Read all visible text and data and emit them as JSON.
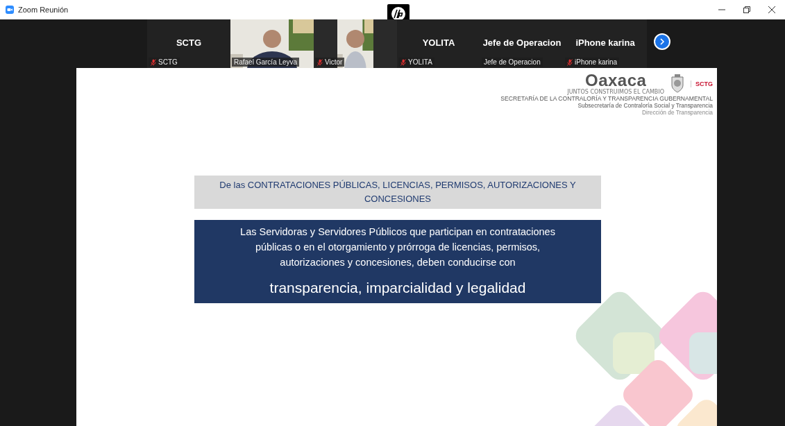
{
  "window": {
    "title": "Zoom Reunión"
  },
  "participants": [
    {
      "kind": "text",
      "display_name": "SCTG",
      "label": "SCTG",
      "muted": true
    },
    {
      "kind": "video",
      "label": "Rafael García Leyva",
      "muted": false
    },
    {
      "kind": "video_narrow",
      "label": "Victor",
      "muted": true
    },
    {
      "kind": "text",
      "display_name": "YOLITA",
      "label": "YOLITA",
      "muted": true
    },
    {
      "kind": "text",
      "display_name": "Jefe de Operacion",
      "label": "Jefe de Operacion",
      "muted": false
    },
    {
      "kind": "text",
      "display_name": "iPhone karina",
      "label": "iPhone karina",
      "muted": true
    }
  ],
  "slide": {
    "logo": {
      "word": "Oaxaca",
      "motto": "JUNTOS CONSTRUIMOS EL CAMBIO",
      "badge": "SCTG"
    },
    "header_lines": [
      "SECRETARÍA DE LA CONTRALORÍA Y TRANSPARENCIA GUBERNAMENTAL",
      "Subsecretaría de Contraloría Social y Transparencia",
      "Dirección de Transparencia"
    ],
    "heading": "De las CONTRATACIONES PÚBLICAS, LICENCIAS, PERMISOS, AUTORIZACIONES Y CONCESIONES",
    "body": "Las Servidoras y Servidores Públicos que participan en contrataciones públicas o en el otorgamiento y prórroga de licencias, permisos, autorizaciones y concesiones, deben conducirse con",
    "emphasis": "transparencia, imparcialidad y legalidad"
  }
}
